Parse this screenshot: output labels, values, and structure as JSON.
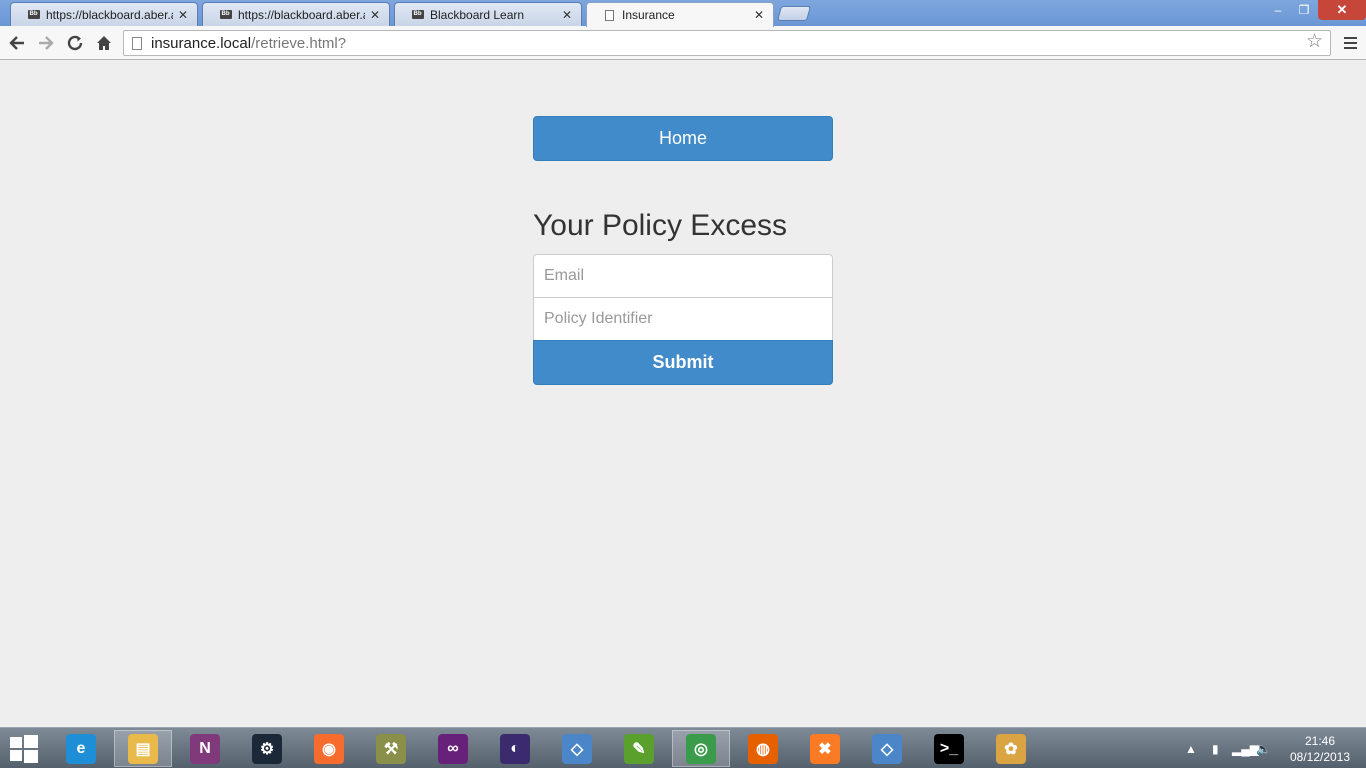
{
  "browser": {
    "tabs": [
      {
        "label": "https://blackboard.aber.ac",
        "icon": "blackboard-icon",
        "active": false
      },
      {
        "label": "https://blackboard.aber.ac",
        "icon": "blackboard-icon",
        "active": false
      },
      {
        "label": "Blackboard Learn",
        "icon": "blackboard-icon",
        "active": false
      },
      {
        "label": "Insurance",
        "icon": "page-icon",
        "active": true
      }
    ],
    "tab_close_glyph": "✕",
    "window_controls": {
      "minimize": "–",
      "maximize": "❐",
      "close": "✕"
    },
    "toolbar": {
      "back_icon": "arrow-left-icon",
      "forward_icon": "arrow-right-icon",
      "reload_icon": "reload-icon",
      "home_icon": "home-icon",
      "url_host": "insurance.local",
      "url_path": "/retrieve.html?",
      "bookmark_icon": "star-icon",
      "menu_icon": "hamburger-menu-icon"
    }
  },
  "page": {
    "home_button": "Home",
    "heading": "Your Policy Excess",
    "email_placeholder": "Email",
    "policy_placeholder": "Policy Identifier",
    "submit_button": "Submit",
    "accent_color": "#428bca",
    "background_color": "#eeeeee"
  },
  "taskbar": {
    "apps": [
      {
        "name": "internet-explorer-icon",
        "color": "#1e8fd6",
        "glyph": "e"
      },
      {
        "name": "file-explorer-icon",
        "color": "#e9b949",
        "glyph": "▤"
      },
      {
        "name": "onenote-icon",
        "color": "#80397b",
        "glyph": "N"
      },
      {
        "name": "steam-icon",
        "color": "#1b2838",
        "glyph": "⚙"
      },
      {
        "name": "origin-icon",
        "color": "#f56c2d",
        "glyph": "◉"
      },
      {
        "name": "tools-icon",
        "color": "#8a8f4a",
        "glyph": "⚒"
      },
      {
        "name": "visual-studio-icon",
        "color": "#68217a",
        "glyph": "∞"
      },
      {
        "name": "eclipse-icon",
        "color": "#3c2a6e",
        "glyph": "◐"
      },
      {
        "name": "virtualbox-icon",
        "color": "#4a86c8",
        "glyph": "◇"
      },
      {
        "name": "notepad-plus-icon",
        "color": "#5aa02c",
        "glyph": "✎"
      },
      {
        "name": "chrome-icon",
        "color": "#3a9b4a",
        "glyph": "◎"
      },
      {
        "name": "firefox-icon",
        "color": "#e66000",
        "glyph": "◍"
      },
      {
        "name": "xampp-icon",
        "color": "#fb7a24",
        "glyph": "✖"
      },
      {
        "name": "virtualbox-icon",
        "color": "#4a86c8",
        "glyph": "◇"
      },
      {
        "name": "command-prompt-icon",
        "color": "#000000",
        "glyph": ">_"
      },
      {
        "name": "paint-icon",
        "color": "#d9a441",
        "glyph": "✿"
      }
    ],
    "tray": {
      "expand": "▲",
      "battery": "▮",
      "signal": "▂▄▆",
      "volume": "🔈"
    },
    "clock_time": "21:46",
    "clock_date": "08/12/2013"
  }
}
